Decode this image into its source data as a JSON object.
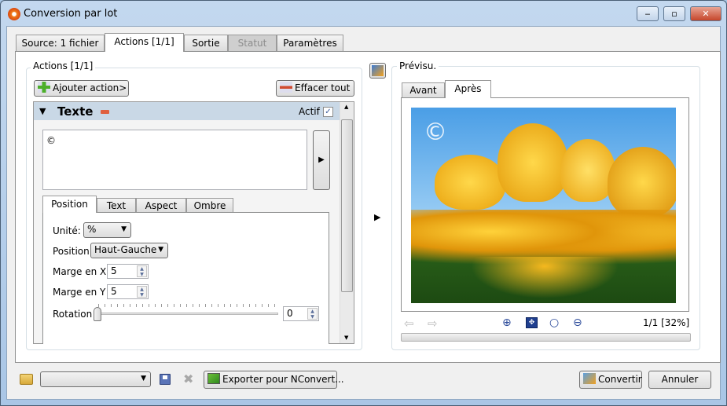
{
  "window": {
    "title": "Conversion par lot",
    "minimize": "‒",
    "maximize": "▫",
    "close": "✕"
  },
  "tabs": [
    {
      "label": "Source: 1 fichier"
    },
    {
      "label": "Actions [1/1]"
    },
    {
      "label": "Sortie"
    },
    {
      "label": "Statut"
    },
    {
      "label": "Paramètres"
    }
  ],
  "actions": {
    "group_label": "Actions [1/1]",
    "add_button": "Ajouter action>",
    "clear_button": "Effacer tout",
    "action_title": "Texte",
    "active_label": "Actif",
    "active_checked": true,
    "text_value": "©",
    "subtabs": [
      {
        "label": "Position"
      },
      {
        "label": "Text"
      },
      {
        "label": "Aspect"
      },
      {
        "label": "Ombre"
      }
    ],
    "unit_label": "Unité:",
    "unit_value": "%",
    "position_label": "Position",
    "position_value": "Haut-Gauche",
    "margin_x_label": "Marge en X",
    "margin_x_value": "5",
    "margin_y_label": "Marge en Y",
    "margin_y_value": "5",
    "rotation_label": "Rotation",
    "rotation_value": "0"
  },
  "preview": {
    "group_label": "Prévisu.",
    "tabs": [
      {
        "label": "Avant"
      },
      {
        "label": "Après"
      }
    ],
    "watermark": "©",
    "page_info": "1/1 [32%]",
    "progress": 0
  },
  "bottom": {
    "combo_value": "",
    "export_button": "Exporter pour NConvert...",
    "convert_button": "Convertir",
    "cancel_button": "Annuler"
  }
}
